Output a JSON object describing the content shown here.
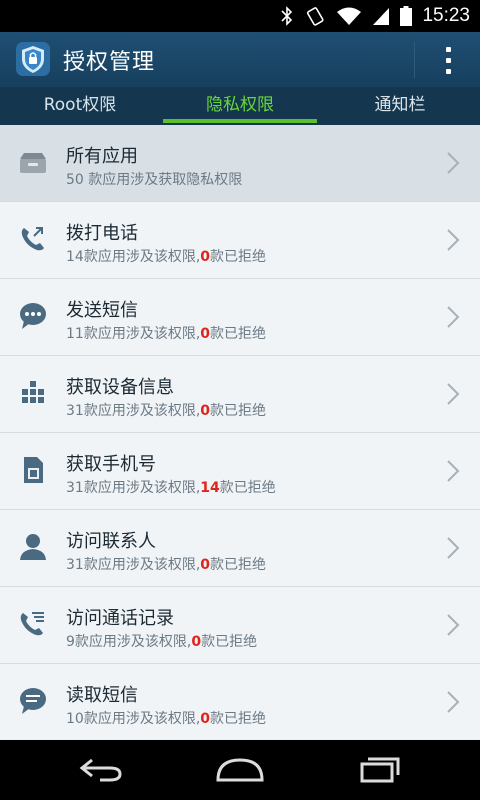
{
  "status_bar": {
    "time": "15:23",
    "icons": [
      "bluetooth-icon",
      "vibrate-icon",
      "wifi-icon",
      "signal-icon",
      "battery-icon"
    ]
  },
  "app": {
    "title": "授权管理",
    "icon": "shield-lock-icon"
  },
  "tabs": [
    {
      "label": "Root权限",
      "active": false
    },
    {
      "label": "隐私权限",
      "active": true
    },
    {
      "label": "通知栏",
      "active": false
    }
  ],
  "list": {
    "items": [
      {
        "title": "所有应用",
        "sub": "50 款应用涉及获取隐私权限",
        "icon": "apps-box-icon"
      },
      {
        "title": "拨打电话",
        "sub_prefix": "14款应用涉及该权限,",
        "count_red": "0",
        "sub_suffix": "款已拒绝",
        "icon": "phone-call-icon"
      },
      {
        "title": "发送短信",
        "sub_prefix": "11款应用涉及该权限,",
        "count_red": "0",
        "sub_suffix": "款已拒绝",
        "icon": "chat-bubble-icon"
      },
      {
        "title": "获取设备信息",
        "sub_prefix": "31款应用涉及该权限,",
        "count_red": "0",
        "sub_suffix": "款已拒绝",
        "icon": "device-grid-icon"
      },
      {
        "title": "获取手机号",
        "sub_prefix": "31款应用涉及该权限,",
        "count_red": "14",
        "sub_suffix": "款已拒绝",
        "icon": "sim-card-icon"
      },
      {
        "title": "访问联系人",
        "sub_prefix": "31款应用涉及该权限,",
        "count_red": "0",
        "sub_suffix": "款已拒绝",
        "icon": "contact-person-icon"
      },
      {
        "title": "访问通话记录",
        "sub_prefix": "9款应用涉及该权限,",
        "count_red": "0",
        "sub_suffix": "款已拒绝",
        "icon": "call-log-icon"
      },
      {
        "title": "读取短信",
        "sub_prefix": "10款应用涉及该权限,",
        "count_red": "0",
        "sub_suffix": "款已拒绝",
        "icon": "message-read-icon"
      }
    ]
  },
  "colors": {
    "action_bar": "#1f4f73",
    "tab_bar": "#14374f",
    "tab_active": "#6ad53a",
    "denied_count": "#e0231b"
  }
}
